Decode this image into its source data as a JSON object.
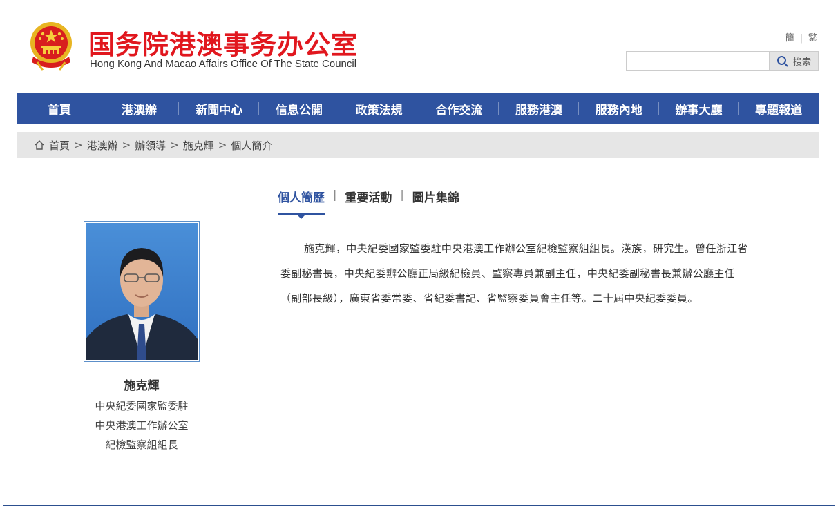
{
  "header": {
    "site_title": "国务院港澳事务办公室",
    "site_subtitle": "Hong Kong And Macao Affairs Office Of The State Council",
    "lang_simplified": "簡",
    "lang_traditional": "繁",
    "lang_separator": "|",
    "search_placeholder": "",
    "search_button": "搜索"
  },
  "nav": {
    "items": [
      "首頁",
      "港澳辦",
      "新聞中心",
      "信息公開",
      "政策法規",
      "合作交流",
      "服務港澳",
      "服務內地",
      "辦事大廳",
      "專題報道"
    ]
  },
  "breadcrumb": {
    "items": [
      "首頁",
      "港澳辦",
      "辦領導",
      "施克輝",
      "個人簡介"
    ],
    "separator": ">"
  },
  "profile": {
    "name": "施克輝",
    "title_lines": [
      "中央紀委國家監委駐",
      "中央港澳工作辦公室",
      "紀檢監察組組長"
    ]
  },
  "tabs": {
    "items": [
      "個人簡歷",
      "重要活動",
      "圖片集錦"
    ],
    "active_index": 0,
    "separator": "|"
  },
  "bio": {
    "text": "施克輝，中央紀委國家監委駐中央港澳工作辦公室紀檢監察組組長。漢族，研究生。曾任浙江省委副秘書長，中央紀委辦公廳正局級紀檢員、監察專員兼副主任，中央紀委副秘書長兼辦公廳主任（副部長級），廣東省委常委、省紀委書記、省監察委員會主任等。二十屆中央紀委委員。"
  },
  "colors": {
    "brand_red": "#e1171e",
    "nav_blue": "#2f53a0",
    "breadcrumb_bg": "#e6e6e6"
  },
  "icons": {
    "emblem": "national-emblem-icon",
    "search": "search-icon",
    "home": "home-icon"
  }
}
